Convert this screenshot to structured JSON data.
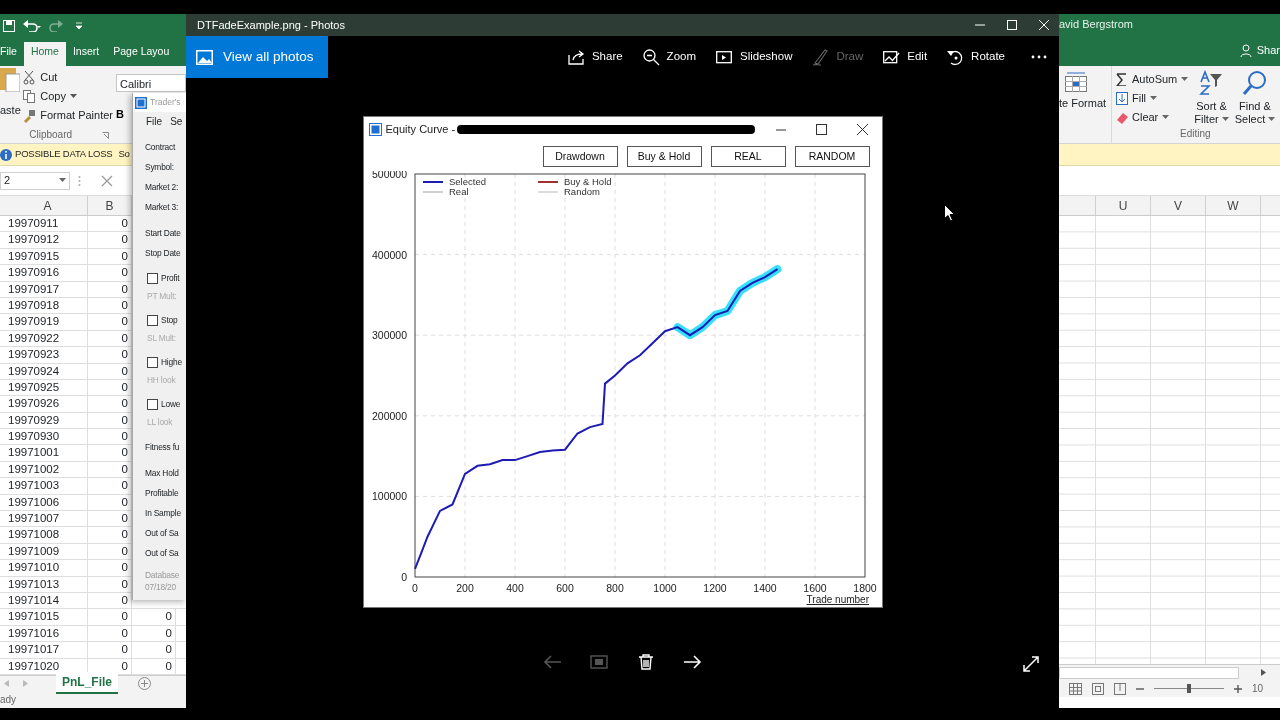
{
  "excel": {
    "user": "avid Bergstrom",
    "share": "Shar",
    "tabs": [
      {
        "label": "File",
        "selected": false
      },
      {
        "label": "Home",
        "selected": true
      },
      {
        "label": "Insert",
        "selected": false
      },
      {
        "label": "Page Layou",
        "selected": false
      }
    ],
    "paste": "aste",
    "clipboard": [
      {
        "kind": "cut",
        "label": "Cut"
      },
      {
        "kind": "copy",
        "label": "Copy"
      },
      {
        "kind": "painter",
        "label": "Format Painter"
      }
    ],
    "clipboard_group": "Clipboard",
    "font_name": "Calibri",
    "bold": "B",
    "format": "te Format",
    "editing": {
      "autosum": "AutoSum",
      "fill": "Fill",
      "clear": "Clear",
      "sort": [
        "Sort &",
        "Filter"
      ],
      "find": [
        "Find &",
        "Select"
      ],
      "group": "Editing"
    },
    "info_bar": {
      "title": "POSSIBLE DATA LOSS",
      "message": "So"
    },
    "name_box": "2",
    "left_columns": [
      "A",
      "B"
    ],
    "right_columns": [
      "U",
      "V",
      "W"
    ],
    "rows": [
      {
        "a": "19970911",
        "b": "0"
      },
      {
        "a": "19970912",
        "b": "0"
      },
      {
        "a": "19970915",
        "b": "0"
      },
      {
        "a": "19970916",
        "b": "0"
      },
      {
        "a": "19970917",
        "b": "0"
      },
      {
        "a": "19970918",
        "b": "0"
      },
      {
        "a": "19970919",
        "b": "0"
      },
      {
        "a": "19970922",
        "b": "0"
      },
      {
        "a": "19970923",
        "b": "0"
      },
      {
        "a": "19970924",
        "b": "0"
      },
      {
        "a": "19970925",
        "b": "0"
      },
      {
        "a": "19970926",
        "b": "0"
      },
      {
        "a": "19970929",
        "b": "0"
      },
      {
        "a": "19970930",
        "b": "0"
      },
      {
        "a": "19971001",
        "b": "0"
      },
      {
        "a": "19971002",
        "b": "0"
      },
      {
        "a": "19971003",
        "b": "0"
      },
      {
        "a": "19971006",
        "b": "0"
      },
      {
        "a": "19971007",
        "b": "0"
      },
      {
        "a": "19971008",
        "b": "0"
      },
      {
        "a": "19971009",
        "b": "0"
      },
      {
        "a": "19971010",
        "b": "0"
      },
      {
        "a": "19971013",
        "b": "0"
      },
      {
        "a": "19971014",
        "b": "0"
      },
      {
        "a": "19971015",
        "b": "0",
        "c": "0"
      },
      {
        "a": "19971016",
        "b": "0",
        "c": "0"
      },
      {
        "a": "19971017",
        "b": "0",
        "c": "0"
      },
      {
        "a": "19971020",
        "b": "0",
        "c": "0"
      }
    ],
    "sheet_tabs": [
      {
        "label": "PnL_File",
        "selected": true
      }
    ],
    "status": "ady",
    "zoom_slider": {
      "level": 0.5
    },
    "zoom": "10"
  },
  "traders_window": {
    "title": "Trader's",
    "menu": [
      "File",
      "Se"
    ],
    "sections": [
      {
        "items": [
          {
            "kind": "label",
            "text": "Contract"
          },
          {
            "kind": "label",
            "text": "Symbol:"
          },
          {
            "kind": "label",
            "text": "Market 2:"
          },
          {
            "kind": "label",
            "text": "Market 3:"
          }
        ]
      },
      {
        "items": [
          {
            "kind": "label",
            "text": "Start Date"
          },
          {
            "kind": "label",
            "text": "Stop Date"
          }
        ]
      },
      {
        "items": [
          {
            "kind": "check",
            "text": "Profit",
            "checked": false
          },
          {
            "kind": "sub",
            "text": "PT Mult:",
            "disabled": true
          }
        ]
      },
      {
        "items": [
          {
            "kind": "check",
            "text": "Stop",
            "checked": false
          },
          {
            "kind": "sub",
            "text": "SL Mult:",
            "disabled": true
          }
        ]
      },
      {
        "items": [
          {
            "kind": "check",
            "text": "Highe",
            "checked": false
          },
          {
            "kind": "sub",
            "text": "HH look",
            "disabled": true
          }
        ]
      },
      {
        "items": [
          {
            "kind": "check",
            "text": "Lowe",
            "checked": false
          },
          {
            "kind": "sub",
            "text": "LL look",
            "disabled": true
          }
        ]
      },
      {
        "items": [
          {
            "kind": "label",
            "text": "Fitness fu"
          }
        ]
      },
      {
        "items": [
          {
            "kind": "label",
            "text": "Max Hold"
          },
          {
            "kind": "label",
            "text": "Profitable"
          },
          {
            "kind": "label",
            "text": "In Sample"
          },
          {
            "kind": "label",
            "text": "Out of Sa"
          },
          {
            "kind": "label",
            "text": "Out of Sa"
          }
        ]
      },
      {
        "items": [
          {
            "kind": "footer",
            "text": "Database"
          },
          {
            "kind": "footer",
            "text": "07/18/20"
          }
        ]
      }
    ]
  },
  "photos": {
    "title": "DTFadeExample.png - Photos",
    "view_all": "View all photos",
    "toolbar": [
      {
        "kind": "share",
        "label": "Share",
        "disabled": false
      },
      {
        "kind": "zoom",
        "label": "Zoom",
        "disabled": false
      },
      {
        "kind": "slideshow",
        "label": "Slideshow",
        "disabled": false
      },
      {
        "kind": "draw",
        "label": "Draw",
        "disabled": true
      },
      {
        "kind": "edit",
        "label": "Edit",
        "disabled": false
      },
      {
        "kind": "rotate",
        "label": "Rotate",
        "disabled": false
      }
    ],
    "nav": [
      {
        "kind": "prev",
        "disabled": true
      },
      {
        "kind": "frame",
        "disabled": true
      },
      {
        "kind": "delete",
        "disabled": false
      },
      {
        "kind": "next",
        "disabled": false
      }
    ]
  },
  "equity_window": {
    "title": "Equity Curve -",
    "buttons": [
      "Drawdown",
      "Buy & Hold",
      "REAL",
      "RANDOM"
    ],
    "legend": [
      {
        "name": "Buy & Hold",
        "color": "#a03030"
      },
      {
        "name": "Real",
        "color": "#d0d0d0"
      },
      {
        "name": "Random",
        "color": "#dcdcdc"
      }
    ],
    "chart_data": {
      "type": "line",
      "xlabel": "Trade number",
      "x": [
        0,
        25,
        50,
        100,
        150,
        200,
        250,
        300,
        350,
        400,
        450,
        500,
        550,
        600,
        650,
        700,
        750,
        760,
        800,
        850,
        900,
        950,
        1000,
        1050,
        1100,
        1150,
        1200,
        1250,
        1300,
        1350,
        1400,
        1450
      ],
      "series": [
        {
          "name": "Selected",
          "color": "#1c1cb4",
          "values": [
            10000,
            30000,
            50000,
            82000,
            90000,
            128000,
            138000,
            140000,
            145000,
            145000,
            150000,
            155000,
            157000,
            158000,
            178000,
            186000,
            190000,
            240000,
            250000,
            265000,
            275000,
            290000,
            305000,
            310000,
            300000,
            310000,
            325000,
            330000,
            355000,
            365000,
            372000,
            382000
          ]
        }
      ],
      "xlim": [
        0,
        1800
      ],
      "ylim": [
        0,
        500000
      ],
      "xticks": [
        0,
        200,
        400,
        600,
        800,
        1000,
        1200,
        1400,
        1600,
        1800
      ],
      "yticks": [
        0,
        100000,
        200000,
        300000,
        400000,
        500000
      ],
      "grid": true
    },
    "tail_highlighted": true
  }
}
